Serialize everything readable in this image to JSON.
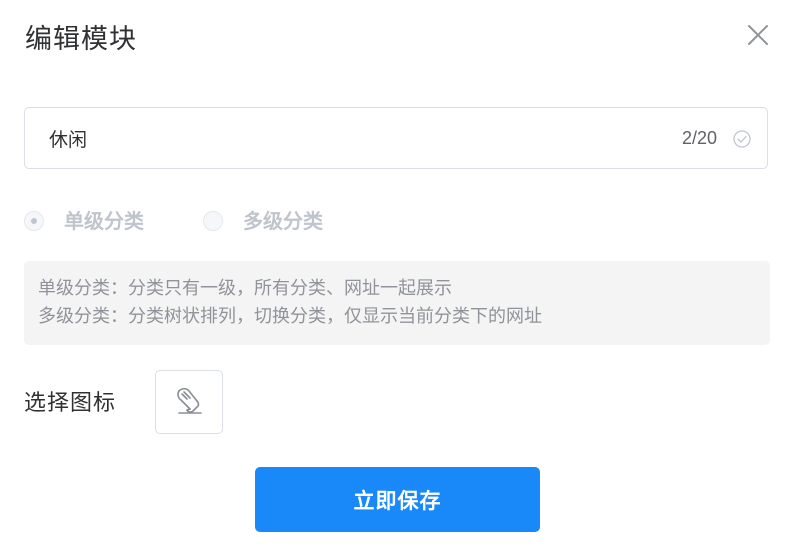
{
  "dialog": {
    "title": "编辑模块"
  },
  "name_field": {
    "value": "休闲",
    "char_count": "2/20"
  },
  "category_mode": {
    "options": [
      {
        "label": "单级分类",
        "selected": true
      },
      {
        "label": "多级分类",
        "selected": false
      }
    ],
    "disabled": true
  },
  "hint": {
    "lines": [
      "单级分类：分类只有一级，所有分类、网址一起展示",
      "多级分类：分类树状排列，切换分类，仅显示当前分类下的网址"
    ]
  },
  "icon_select": {
    "label": "选择图标",
    "selected_icon": "palm-hand-icon"
  },
  "actions": {
    "save_label": "立即保存"
  },
  "colors": {
    "primary": "#1989fa",
    "hint_background": "#f4f4f5",
    "disabled_text": "#c0c4cc",
    "success_check": "#c0c4cc"
  }
}
